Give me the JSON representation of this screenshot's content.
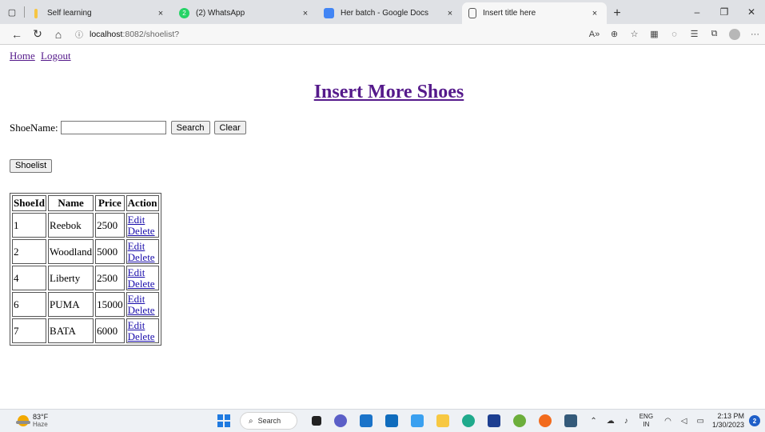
{
  "browser": {
    "tabs": [
      {
        "title": "Self learning",
        "icon": "bookmark-folder-icon",
        "active": false
      },
      {
        "title": "(2) WhatsApp",
        "icon": "whatsapp-icon",
        "badge": "2",
        "active": false
      },
      {
        "title": "Her batch - Google Docs",
        "icon": "google-docs-icon",
        "active": false
      },
      {
        "title": "Insert title here",
        "icon": "page-icon",
        "active": true
      }
    ],
    "close_glyph": "×",
    "new_tab_glyph": "+",
    "address": {
      "host": "localhost",
      "path": ":8082/shoelist?"
    }
  },
  "page": {
    "links": {
      "home": "Home",
      "logout": "Logout"
    },
    "heading": "Insert More Shoes",
    "search": {
      "label": "ShoeName:",
      "value": "",
      "search_button": "Search",
      "clear_button": "Clear"
    },
    "shoelist_button": "Shoelist",
    "table": {
      "headers": [
        "ShoeId",
        "Name",
        "Price",
        "Action"
      ],
      "rows": [
        {
          "id": "1",
          "name": "Reebok",
          "price": "2500"
        },
        {
          "id": "2",
          "name": "Woodland",
          "price": "5000"
        },
        {
          "id": "4",
          "name": "Liberty",
          "price": "2500"
        },
        {
          "id": "6",
          "name": "PUMA",
          "price": "15000"
        },
        {
          "id": "7",
          "name": "BATA",
          "price": "6000"
        }
      ],
      "edit_label": "Edit",
      "delete_label": "Delete"
    }
  },
  "taskbar": {
    "weather": {
      "temp": "83°F",
      "desc": "Haze"
    },
    "search_label": "Search",
    "language": {
      "line1": "ENG",
      "line2": "IN"
    },
    "time": "2:13 PM",
    "date": "1/30/2023",
    "notification_count": "2"
  },
  "colors": {
    "link": "#1a0dab",
    "visited": "#551a8b",
    "accent": "#1f7ae0"
  }
}
